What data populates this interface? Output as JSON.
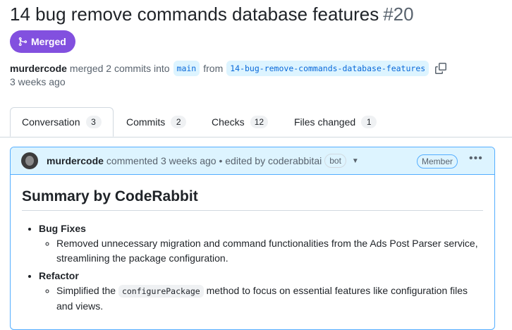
{
  "pr": {
    "title": "14 bug remove commands database features",
    "number": "#20",
    "status": "Merged",
    "author": "murdercode",
    "merge_text": "merged 2 commits into",
    "base_branch": "main",
    "from_text": "from",
    "head_branch": "14-bug-remove-commands-database-features",
    "time_ago": "3 weeks ago",
    "accent_color": "#8250df"
  },
  "tabs": [
    {
      "label": "Conversation",
      "count": "3"
    },
    {
      "label": "Commits",
      "count": "2"
    },
    {
      "label": "Checks",
      "count": "12"
    },
    {
      "label": "Files changed",
      "count": "1"
    }
  ],
  "comment": {
    "author": "murdercode",
    "meta": "commented 3 weeks ago • edited by coderabbitai",
    "bot_label": "bot",
    "role": "Member",
    "summary_title": "Summary by CodeRabbit",
    "sections": [
      {
        "heading": "Bug Fixes",
        "items": [
          "Removed unnecessary migration and command functionalities from the Ads Post Parser service, streamlining the package configuration."
        ]
      },
      {
        "heading": "Refactor",
        "item_prefix": "Simplified the",
        "item_code": "configurePackage",
        "item_suffix": "method to focus on essential features like configuration files and views."
      }
    ]
  },
  "icons": {
    "merge": "git-merge-icon",
    "copy": "copy-icon",
    "caret": "triangle-down-icon",
    "kebab": "kebab-horizontal-icon"
  }
}
